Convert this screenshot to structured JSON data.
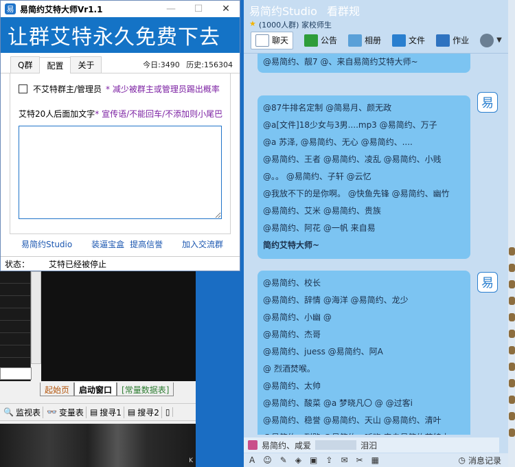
{
  "tool_window": {
    "title": "易简约艾特大师Vr1.1",
    "icon_char": "易",
    "controls": [
      "—",
      "☐",
      "✕"
    ],
    "banner": "让群艾特永久免费下去",
    "tabs": [
      "Q群",
      "配置",
      "关于"
    ],
    "stats": {
      "today_label": "今日:3490",
      "history_label": "历史:156304"
    },
    "checkbox_label": "不艾特群主/管理员",
    "checkbox_hint": "* 减少被群主或管理员踢出概率",
    "tail_label": "艾特20人后面加文字",
    "tail_hint": "* 宣传语/不能回车/不添加则小尾巴",
    "links": [
      "易简约Studio",
      "装逼宝盒",
      "提高信誉",
      "加入交流群"
    ],
    "status_label": "状态：",
    "status_value": "艾特已经被停止"
  },
  "ide": {
    "tabs": [
      "起始页",
      "启动窗口",
      "[常量数据表]"
    ],
    "toolbar": [
      "监视表",
      "变量表",
      "搜寻1",
      "搜寻2"
    ],
    "corner_text": "K"
  },
  "chat": {
    "title": "易简约Studio",
    "title_right": "看群规",
    "subtitle": "(1000人群) 家校师生",
    "tabs": [
      "聊天",
      "公告",
      "相册",
      "文件",
      "作业"
    ],
    "messages": [
      {
        "lines": [
          "@易简约、靓7 @、来自易简约艾特大师~"
        ]
      },
      {
        "lines": [
          "@87牛排名定制 @简易月、颜无政",
          "@a[文件]18少女与3男....mp3 @易简约、万子",
          "@a 苏泽, @易简约、无心 @易简约、....",
          "@易简约、王者 @易简约、凌乱 @易简约、小贱",
          "@。。 @易简约、子轩 @云忆",
          "@我放不下的是你啊。 @快鱼先锋 @易简约、幽竹",
          "@易简约、艾米 @易简约、贵族",
          "@易简约、阿花                    @一帆 来自易",
          "简约艾特大师~"
        ]
      },
      {
        "lines": [
          "@易简约、校长",
          "@易简约、辞情 @海洋 @易简约、龙少",
          "@易简约、小幽 @",
          "@易简约、杰哥",
          "@易简约、juess @易简约、阿A",
          "@          烈酒焚喉。",
          "@易简约、太帅",
          "@易简约、酸菜 @a  梦晓凡〇 @        @过客i",
          "@易简约、稳誉 @易简约、天山 @易简约、清叶",
          "@易简约、列路 @易简约、听晓  来自易简约艾特大"
        ]
      }
    ],
    "avatar_char": "易",
    "preview_left": "易简约、咸爱",
    "preview_right": "泪汩",
    "history_label": "消息记录"
  }
}
